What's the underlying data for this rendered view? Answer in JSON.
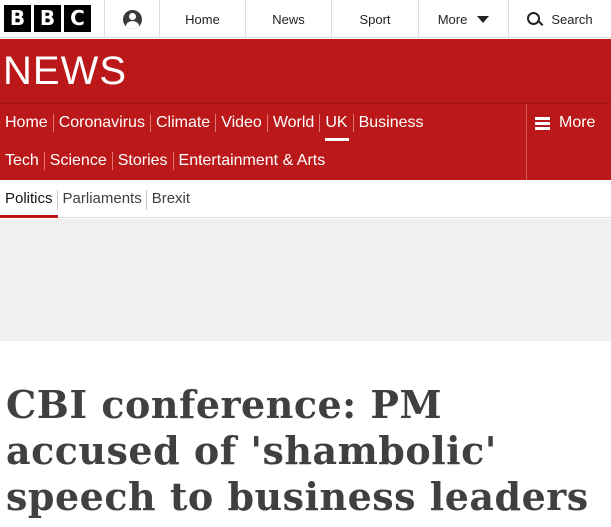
{
  "global_nav": {
    "logo_letters": [
      "B",
      "B",
      "C"
    ],
    "account_icon": "user-account-icon",
    "home": "Home",
    "news": "News",
    "sport": "Sport",
    "more": "More",
    "search": "Search"
  },
  "masthead": {
    "logo": "NEWS",
    "row1": [
      "Home",
      "Coronavirus",
      "Climate",
      "Video",
      "World",
      "UK",
      "Business"
    ],
    "row2": [
      "Tech",
      "Science",
      "Stories",
      "Entertainment & Arts"
    ],
    "active": "UK",
    "more": "More",
    "bg_color": "#bb1919"
  },
  "subnav": {
    "items": [
      "Politics",
      "Parliaments",
      "Brexit"
    ],
    "active": "Politics",
    "accent_color": "#bb1919"
  },
  "article": {
    "headline": "CBI conference: PM accused of 'shambolic' speech to business leaders"
  }
}
